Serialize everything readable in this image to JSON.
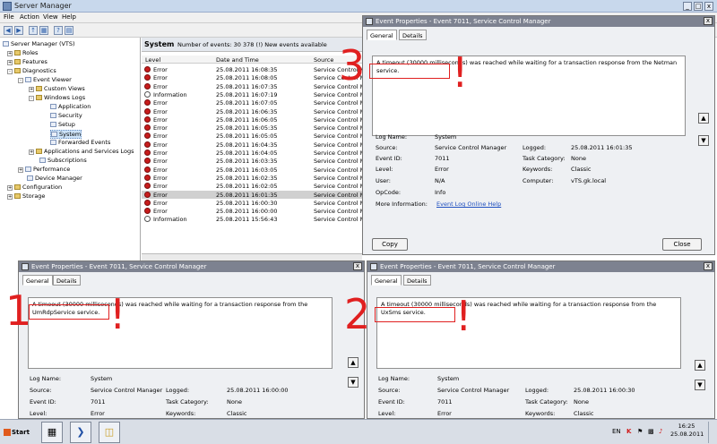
{
  "window": {
    "title": "Server Manager"
  },
  "menu": [
    "File",
    "Action",
    "View",
    "Help"
  ],
  "tree": {
    "items": [
      {
        "label": "Server Manager (VTS)"
      },
      {
        "label": "Roles"
      },
      {
        "label": "Features"
      },
      {
        "label": "Diagnostics"
      },
      {
        "label": "Event Viewer"
      },
      {
        "label": "Custom Views"
      },
      {
        "label": "Windows Logs"
      },
      {
        "label": "Application"
      },
      {
        "label": "Security"
      },
      {
        "label": "Setup"
      },
      {
        "label": "System"
      },
      {
        "label": "Forwarded Events"
      },
      {
        "label": "Applications and Services Logs"
      },
      {
        "label": "Subscriptions"
      },
      {
        "label": "Performance"
      },
      {
        "label": "Device Manager"
      },
      {
        "label": "Configuration"
      },
      {
        "label": "Storage"
      }
    ]
  },
  "events_panel": {
    "heading": "System",
    "count_text": "Number of events: 30 378 (!) New events available",
    "columns": [
      "Level",
      "Date and Time",
      "Source"
    ],
    "rows": [
      {
        "level": "Error",
        "datetime": "25.08.2011 16:08:35",
        "source": "Service Control M"
      },
      {
        "level": "Error",
        "datetime": "25.08.2011 16:08:05",
        "source": "Service Control M"
      },
      {
        "level": "Error",
        "datetime": "25.08.2011 16:07:35",
        "source": "Service Control M"
      },
      {
        "level": "Information",
        "datetime": "25.08.2011 16:07:19",
        "source": "Service Control M"
      },
      {
        "level": "Error",
        "datetime": "25.08.2011 16:07:05",
        "source": "Service Control M"
      },
      {
        "level": "Error",
        "datetime": "25.08.2011 16:06:35",
        "source": "Service Control M"
      },
      {
        "level": "Error",
        "datetime": "25.08.2011 16:06:05",
        "source": "Service Control M"
      },
      {
        "level": "Error",
        "datetime": "25.08.2011 16:05:35",
        "source": "Service Control M"
      },
      {
        "level": "Error",
        "datetime": "25.08.2011 16:05:05",
        "source": "Service Control M"
      },
      {
        "level": "Error",
        "datetime": "25.08.2011 16:04:35",
        "source": "Service Control M"
      },
      {
        "level": "Error",
        "datetime": "25.08.2011 16:04:05",
        "source": "Service Control M"
      },
      {
        "level": "Error",
        "datetime": "25.08.2011 16:03:35",
        "source": "Service Control M"
      },
      {
        "level": "Error",
        "datetime": "25.08.2011 16:03:05",
        "source": "Service Control M"
      },
      {
        "level": "Error",
        "datetime": "25.08.2011 16:02:35",
        "source": "Service Control M"
      },
      {
        "level": "Error",
        "datetime": "25.08.2011 16:02:05",
        "source": "Service Control M"
      },
      {
        "level": "Error",
        "datetime": "25.08.2011 16:01:35",
        "source": "Service Control M"
      },
      {
        "level": "Error",
        "datetime": "25.08.2011 16:00:30",
        "source": "Service Control M"
      },
      {
        "level": "Error",
        "datetime": "25.08.2011 16:00:00",
        "source": "Service Control M"
      },
      {
        "level": "Information",
        "datetime": "25.08.2011 15:56:43",
        "source": "Service Control M"
      }
    ]
  },
  "dialog3": {
    "title": "Event Properties - Event 7011, Service Control Manager",
    "tab_general": "General",
    "tab_details": "Details",
    "message": "A timeout (30000 milliseconds) was reached while waiting for a transaction response from the Netman service.",
    "log_name_label": "Log Name:",
    "log_name": "System",
    "source_label": "Source:",
    "source": "Service Control Manager",
    "logged_label": "Logged:",
    "logged": "25.08.2011 16:01:35",
    "event_id_label": "Event ID:",
    "event_id": "7011",
    "task_label": "Task Category:",
    "task": "None",
    "level_label": "Level:",
    "level": "Error",
    "keywords_label": "Keywords:",
    "keywords": "Classic",
    "user_label": "User:",
    "user": "N/A",
    "computer_label": "Computer:",
    "computer": "vTS.gk.local",
    "opcode_label": "OpCode:",
    "opcode": "Info",
    "more_info_label": "More Information:",
    "more_info_link": "Event Log Online Help",
    "copy_label": "Copy",
    "close_label": "Close"
  },
  "dialog1": {
    "title": "Event Properties - Event 7011, Service Control Manager",
    "tab_general": "General",
    "tab_details": "Details",
    "message": "A timeout (30000 milliseconds) was reached while waiting for a transaction response from the UmRdpService service.",
    "log_name_label": "Log Name:",
    "log_name": "System",
    "source_label": "Source:",
    "source": "Service Control Manager",
    "logged_label": "Logged:",
    "logged": "25.08.2011 16:00:00",
    "event_id_label": "Event ID:",
    "event_id": "7011",
    "task_label": "Task Category:",
    "task": "None",
    "level_label": "Level:",
    "level": "Error",
    "keywords_label": "Keywords:",
    "keywords": "Classic"
  },
  "dialog2": {
    "title": "Event Properties - Event 7011, Service Control Manager",
    "tab_general": "General",
    "tab_details": "Details",
    "message": "A timeout (30000 milliseconds) was reached while waiting for a transaction response from the UxSms service.",
    "log_name_label": "Log Name:",
    "log_name": "System",
    "source_label": "Source:",
    "source": "Service Control Manager",
    "logged_label": "Logged:",
    "logged": "25.08.2011 16:00:30",
    "event_id_label": "Event ID:",
    "event_id": "7011",
    "task_label": "Task Category:",
    "task": "None",
    "level_label": "Level:",
    "level": "Error",
    "keywords_label": "Keywords:",
    "keywords": "Classic"
  },
  "annotations": {
    "n1": "1",
    "n2": "2",
    "n3": "3",
    "excl": "!"
  },
  "taskbar": {
    "start_label": "Start",
    "lang": "EN",
    "time": "16:25",
    "date": "25.08.2011"
  },
  "colors": {
    "annotation_red": "#e02020",
    "error_red": "#c81c1c"
  }
}
